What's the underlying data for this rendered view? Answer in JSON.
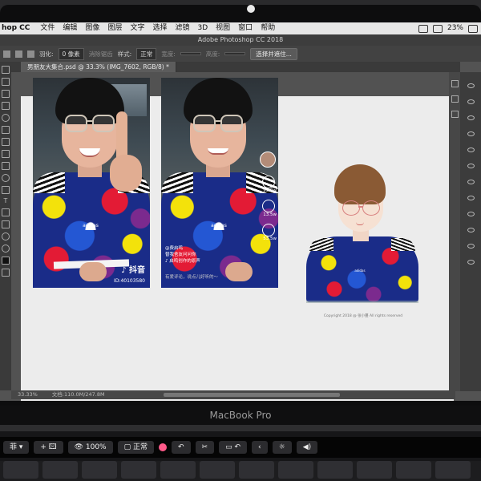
{
  "menubar": {
    "app": "hop CC",
    "items": [
      "文件",
      "编辑",
      "图像",
      "图层",
      "文字",
      "选择",
      "滤镜",
      "3D",
      "视图",
      "窗口",
      "帮助"
    ],
    "battery": "23%"
  },
  "titlebar": {
    "title": "Adobe Photoshop CC 2018"
  },
  "options": {
    "feather_label": "羽化:",
    "feather_value": "0 像素",
    "antialias": "消除锯齿",
    "style_label": "样式:",
    "style_value": "正常",
    "width_label": "宽度:",
    "height_label": "高度:",
    "select_mask_button": "选择并遮住..."
  },
  "document": {
    "tab_title": "男朋友大集合.psd @ 33.3% (IMG_7602, RGB/8) *"
  },
  "status": {
    "zoom": "33.33%",
    "doc_info": "文档:110.0M/247.8M"
  },
  "phone1": {
    "app_name": "抖音",
    "user_id": "ID:40103580"
  },
  "phone2": {
    "username": "@费启鸣",
    "caption": "替我舍友问问你",
    "music": "♪ 启鸣创作的原声",
    "likes": "95.2w",
    "comments": "13.5w",
    "shares": "53.5w",
    "reply_placeholder": "有爱评论，说点儿好听的～"
  },
  "illustration": {
    "copyright": "Copyright 2018 @ 张小蔓 All rights reserved"
  },
  "laptop": {
    "brand": "MacBook Pro"
  },
  "touchbar": {
    "keys": [
      "菲 ▾",
      "+ 🖾",
      "👁 100%",
      "▢ 正常",
      "↶",
      "✂",
      "▭ ↶",
      "‹",
      "☼",
      "◀)"
    ]
  }
}
